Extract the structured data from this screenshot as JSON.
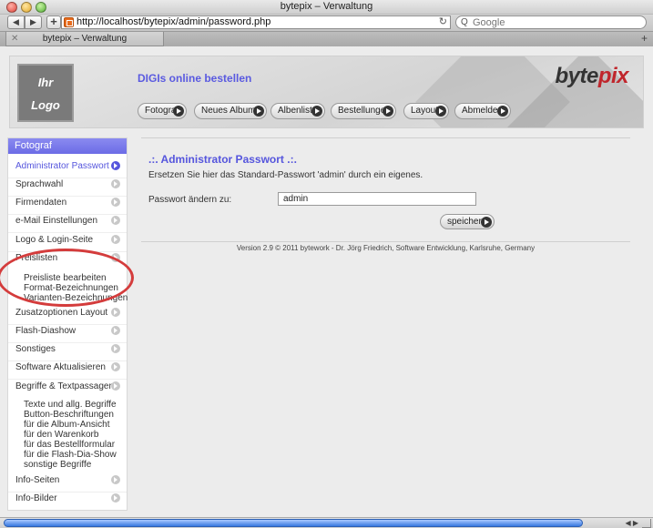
{
  "window": {
    "title": "bytepix – Verwaltung"
  },
  "browser": {
    "back_label": "◀",
    "forward_label": "▶",
    "add_label": "+",
    "url": "http://localhost/bytepix/admin/password.php",
    "reload_label": "↻",
    "search_placeholder": "Google",
    "search_icon": "Q",
    "tab_title": "bytepix – Verwaltung",
    "tab_close": "✕",
    "new_tab": "+"
  },
  "header": {
    "logo_line1": "Ihr",
    "logo_line2": "Logo",
    "slogan": "DIGIs online bestellen",
    "brand_part1": "byte",
    "brand_part2": "pix",
    "nav": [
      "Fotograf",
      "Neues Album",
      "Albenliste",
      "Bestellungen",
      "Layout",
      "Abmelden"
    ]
  },
  "sidebar": {
    "heading": "Fotograf",
    "items": [
      "Administrator Passwort",
      "Sprachwahl",
      "Firmendaten",
      "e-Mail Einstellungen",
      "Logo & Login-Seite",
      "Preislisten",
      "Zusatzoptionen Layout",
      "Flash-Diashow",
      "Sonstiges",
      "Software Aktualisieren",
      "Begriffe & Textpassagen",
      "Info-Seiten",
      "Info-Bilder"
    ],
    "preislisten_sub": [
      "Preisliste bearbeiten",
      "Format-Bezeichnungen",
      "Varianten-Bezeichnungen"
    ],
    "begriffe_sub": [
      "Texte und allg. Begriffe",
      "Button-Beschriftungen",
      "für die Album-Ansicht",
      "für den Warenkorb",
      "für das Bestellformular",
      "für die Flash-Dia-Show",
      "sonstige Begriffe"
    ]
  },
  "main": {
    "title": ".:. Administrator Passwort .:.",
    "description": "Ersetzen Sie hier das Standard-Passwort 'admin' durch ein eigenes.",
    "password_label": "Passwort ändern zu:",
    "password_value": "admin",
    "save_label": "speichern",
    "footer": "Version 2.9 © 2011 bytework - Dr. Jörg Friedrich, Software Entwicklung, Karlsruhe, Germany"
  },
  "colors": {
    "accent": "#5555dd",
    "annotation": "#d43c3c"
  }
}
